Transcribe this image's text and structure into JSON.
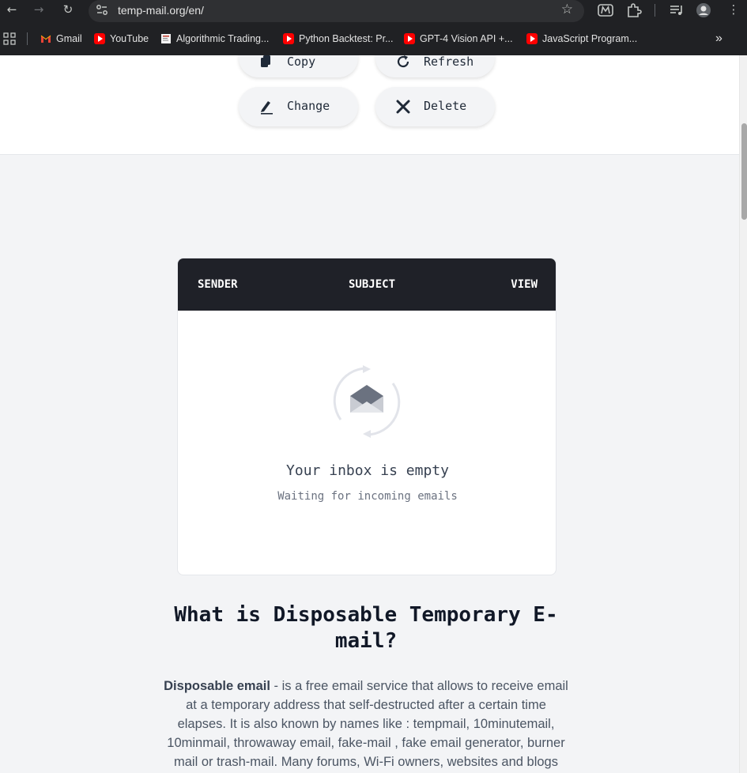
{
  "browser": {
    "url": "temp-mail.org/en/",
    "bookmarks": [
      {
        "label": "Gmail",
        "icon": "gmail-icon"
      },
      {
        "label": "YouTube",
        "icon": "youtube-icon"
      },
      {
        "label": "Algorithmic Trading...",
        "icon": "page-icon"
      },
      {
        "label": "Python Backtest: Pr...",
        "icon": "youtube-icon"
      },
      {
        "label": "GPT-4 Vision API +...",
        "icon": "youtube-icon"
      },
      {
        "label": "JavaScript Program...",
        "icon": "youtube-icon"
      }
    ],
    "overflow_label": "»"
  },
  "actions": {
    "copy_label": "Copy",
    "refresh_label": "Refresh",
    "change_label": "Change",
    "delete_label": "Delete"
  },
  "inbox": {
    "columns": [
      "SENDER",
      "SUBJECT",
      "VIEW"
    ],
    "empty_title": "Your inbox is empty",
    "empty_subtitle": "Waiting for incoming emails"
  },
  "article": {
    "title": "What is Disposable Temporary E-mail?",
    "lead_bold": "Disposable email",
    "body": " - is a free email service that allows to receive email at a temporary address that self-destructed after a certain time elapses. It is also known by names like : tempmail, 10minutemail, 10minmail, throwaway email, fake-mail , fake email generator, burner mail or trash-mail. Many forums, Wi-Fi owners, websites and blogs ask visitors to"
  },
  "colors": {
    "chrome_bg": "#202124",
    "page_bg": "#f3f4f6",
    "inbox_header_bg": "#1f2128"
  }
}
